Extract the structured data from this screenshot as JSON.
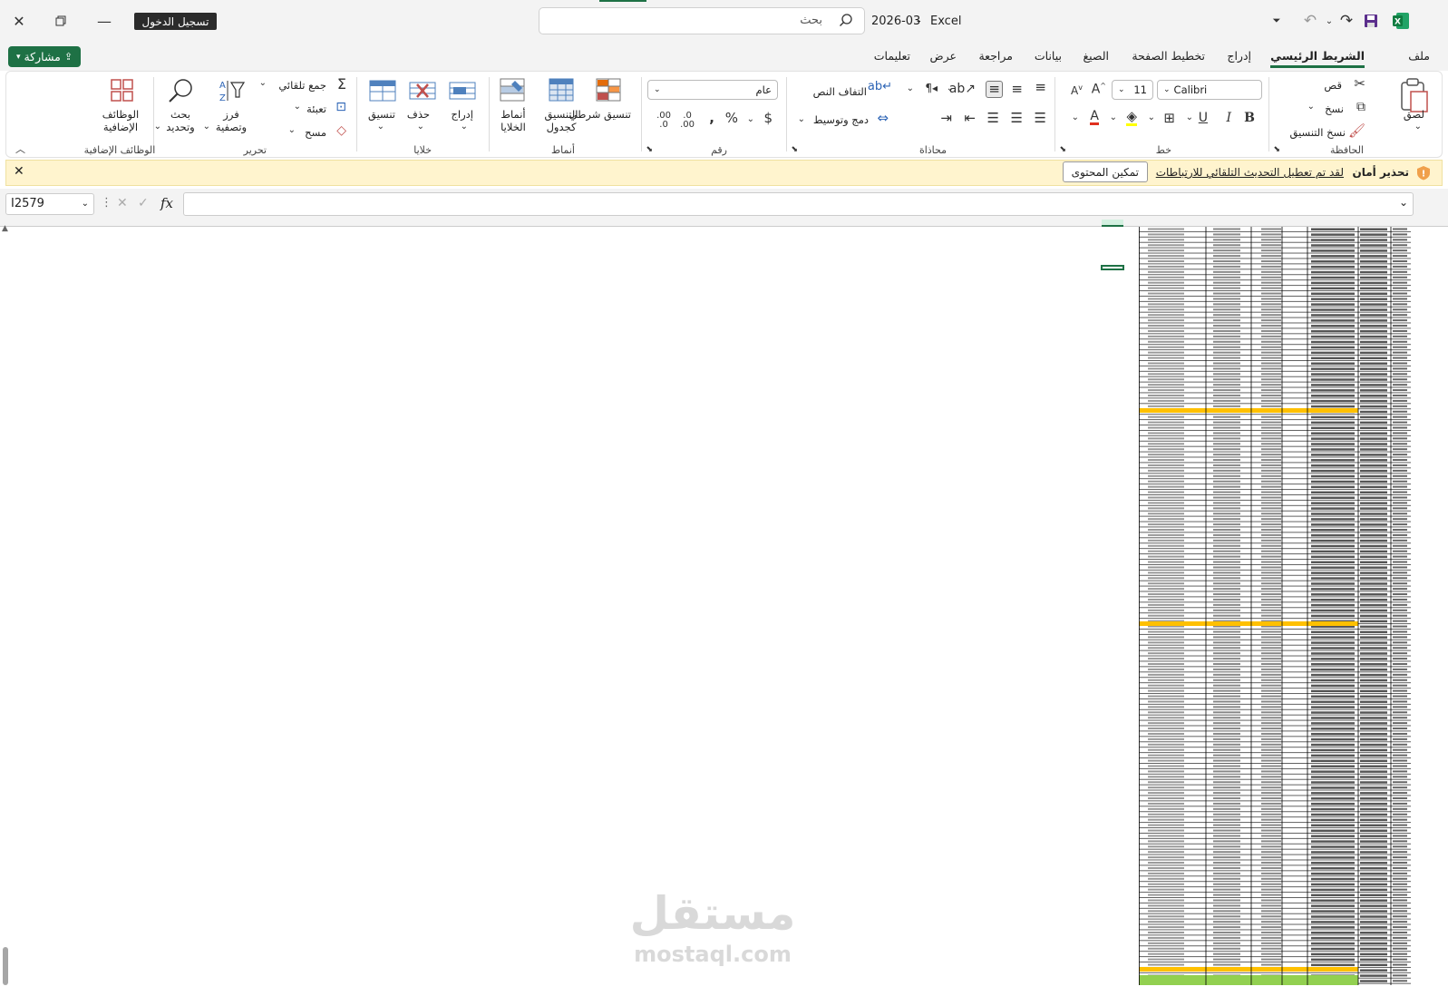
{
  "titlebar": {
    "app_name": "Excel",
    "file_name": "2026-03",
    "search_placeholder": "بحث",
    "signin_label": "تسجيل الدخول"
  },
  "tabs": [
    "ملف",
    "الشريط الرئيسي",
    "إدراج",
    "تخطيط الصفحة",
    "الصيغ",
    "بيانات",
    "مراجعة",
    "عرض",
    "تعليمات"
  ],
  "share_label": "مشاركة",
  "ribbon": {
    "clipboard": {
      "paste": "لصق",
      "cut": "قص",
      "copy": "نسخ",
      "format_painter": "نسخ التنسيق",
      "group": "الحافظة"
    },
    "font": {
      "name": "Calibri",
      "size": "11",
      "group": "خط"
    },
    "alignment": {
      "wrap": "التفاف النص",
      "merge": "دمج وتوسيط",
      "group": "محاذاة"
    },
    "number": {
      "format": "عام",
      "group": "رقم"
    },
    "styles": {
      "conditional": "تنسيق شرطي",
      "table": "التنسيق كجدول",
      "cell_styles": "أنماط الخلايا",
      "group": "أنماط"
    },
    "cells": {
      "insert": "إدراج",
      "delete": "حذف",
      "format": "تنسيق",
      "group": "خلايا"
    },
    "editing": {
      "autosum": "جمع تلقائي",
      "fill": "تعبئة",
      "clear": "مسح",
      "sort": "فرز وتصفية",
      "find": "بحث وتحديد",
      "group": "تحرير"
    },
    "addins": {
      "label": "الوظائف الإضافية",
      "group": "الوظائف الإضافية"
    }
  },
  "security": {
    "title": "تحذير أمان",
    "message": "لقد تم تعطيل التحديث التلقائي للارتباطات",
    "button": "تمكين المحتوى"
  },
  "formula_bar": {
    "name_box": "I2579",
    "fx": "fx",
    "value": ""
  },
  "watermark": {
    "arabic": "مستقل",
    "latin": "mostaql.com"
  },
  "colors": {
    "excel_green": "#1e7145",
    "highlight_yellow": "#ffc000",
    "total_green": "#92d050",
    "warning_bar": "#fff4ce"
  }
}
